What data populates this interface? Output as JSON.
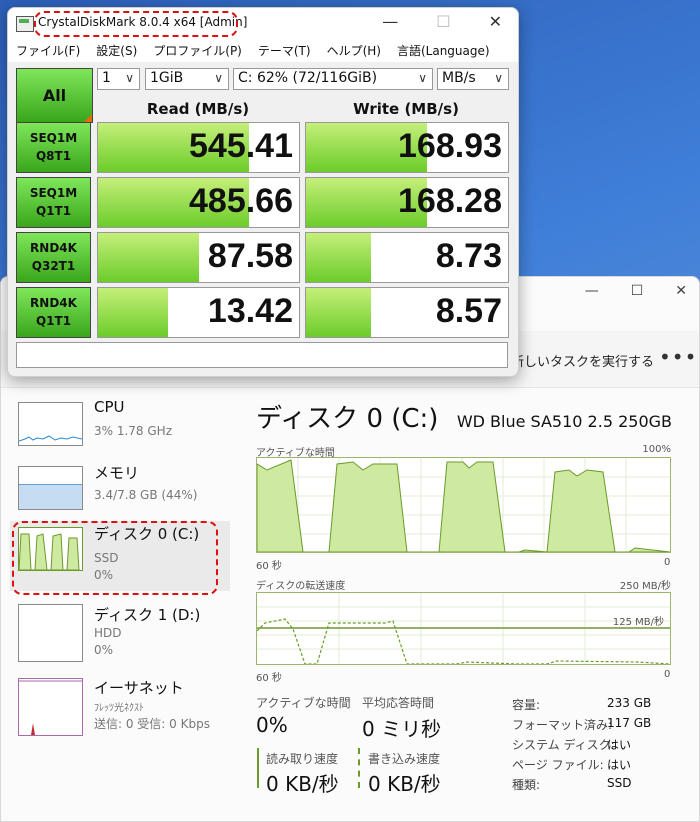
{
  "cdm": {
    "title": "CrystalDiskMark 8.0.4 x64 [Admin]",
    "menu": [
      "ファイル(F)",
      "設定(S)",
      "プロファイル(P)",
      "テーマ(T)",
      "ヘルプ(H)",
      "言語(Language)"
    ],
    "all_label": "All",
    "count": "1",
    "size": "1GiB",
    "drive": "C: 62% (72/116GiB)",
    "unit": "MB/s",
    "read_header": "Read (MB/s)",
    "write_header": "Write (MB/s)",
    "rows": [
      {
        "l1": "SEQ1M",
        "l2": "Q8T1",
        "read": "545.41",
        "write": "168.93",
        "read_fill": 0.75,
        "write_fill": 0.6
      },
      {
        "l1": "SEQ1M",
        "l2": "Q1T1",
        "read": "485.66",
        "write": "168.28",
        "read_fill": 0.75,
        "write_fill": 0.6
      },
      {
        "l1": "RND4K",
        "l2": "Q32T1",
        "read": "87.58",
        "write": "8.73",
        "read_fill": 0.5,
        "write_fill": 0.32
      },
      {
        "l1": "RND4K",
        "l2": "Q1T1",
        "read": "13.42",
        "write": "8.57",
        "read_fill": 0.35,
        "write_fill": 0.32
      }
    ]
  },
  "tm": {
    "run_task": "新しいタスクを実行する",
    "sidebar": [
      {
        "name": "CPU",
        "sub1": "3% 1.78 GHz",
        "sub2": ""
      },
      {
        "name": "メモリ",
        "sub1": "3.4/7.8 GB (44%)",
        "sub2": ""
      },
      {
        "name": "ディスク 0 (C:)",
        "sub1": "SSD",
        "sub2": "0%"
      },
      {
        "name": "ディスク 1 (D:)",
        "sub1": "HDD",
        "sub2": "0%"
      },
      {
        "name": "イーサネット",
        "sub1": "ﾌﾚｯﾂ光ﾈｸｽﾄ",
        "sub2": "送信: 0 受信: 0 Kbps"
      }
    ],
    "title": "ディスク 0 (C:)",
    "model": "WD Blue SA510 2.5 250GB",
    "active_label": "アクティブな時間",
    "active_max": "100%",
    "time_left": "60 秒",
    "time_right": "0",
    "transfer_label": "ディスクの転送速度",
    "transfer_max": "250 MB/秒",
    "transfer_mid": "125 MB/秒",
    "stats": {
      "active_lbl": "アクティブな時間",
      "active_val": "0%",
      "resp_lbl": "平均応答時間",
      "resp_val": "0 ミリ秒",
      "read_lbl": "読み取り速度",
      "read_val": "0 KB/秒",
      "write_lbl": "書き込み速度",
      "write_val": "0 KB/秒"
    },
    "info": [
      {
        "k": "容量:",
        "v": "233 GB"
      },
      {
        "k": "フォーマット済み:",
        "v": "117 GB"
      },
      {
        "k": "システム ディスク:",
        "v": "はい"
      },
      {
        "k": "ページ ファイル:",
        "v": "はい"
      },
      {
        "k": "種類:",
        "v": "SSD"
      }
    ]
  }
}
